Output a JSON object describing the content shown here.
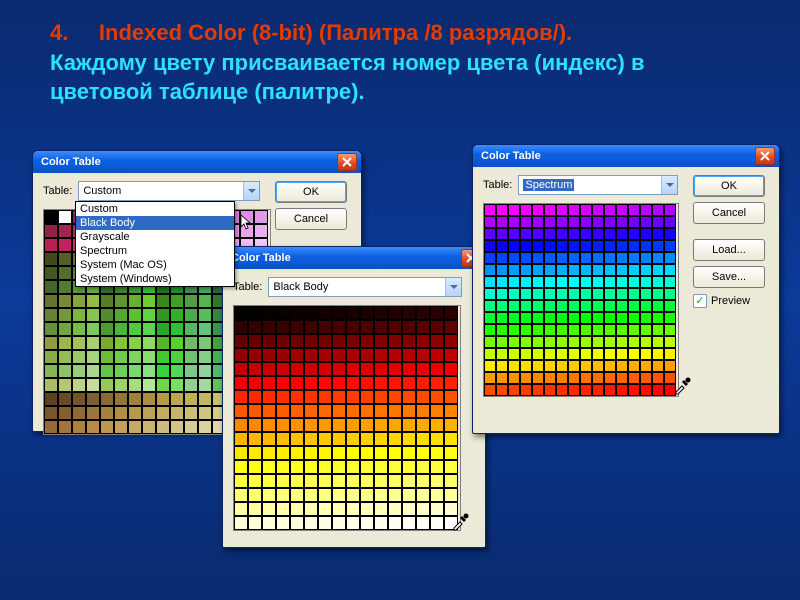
{
  "heading_num": "4.",
  "heading_title": "Indexed Color (8-bit) (Палитра /8 разрядов/).",
  "heading_sub": "Каждому цвету присваивается номер цвета (индекс) в цветовой таблице (палитре).",
  "dialog_title": "Color Table",
  "table_label": "Table:",
  "btn_ok": "OK",
  "btn_cancel": "Cancel",
  "btn_load": "Load...",
  "btn_save": "Save...",
  "preview_label": "Preview",
  "dlg1": {
    "selected": "Custom",
    "dropdown_open_value": "Custom",
    "options": [
      "Custom",
      "Black Body",
      "Grayscale",
      "Spectrum",
      "System (Mac OS)",
      "System (Windows)"
    ],
    "highlight_index": 1
  },
  "dlg2": {
    "selected": "Black Body"
  },
  "dlg3": {
    "selected": "Spectrum"
  }
}
